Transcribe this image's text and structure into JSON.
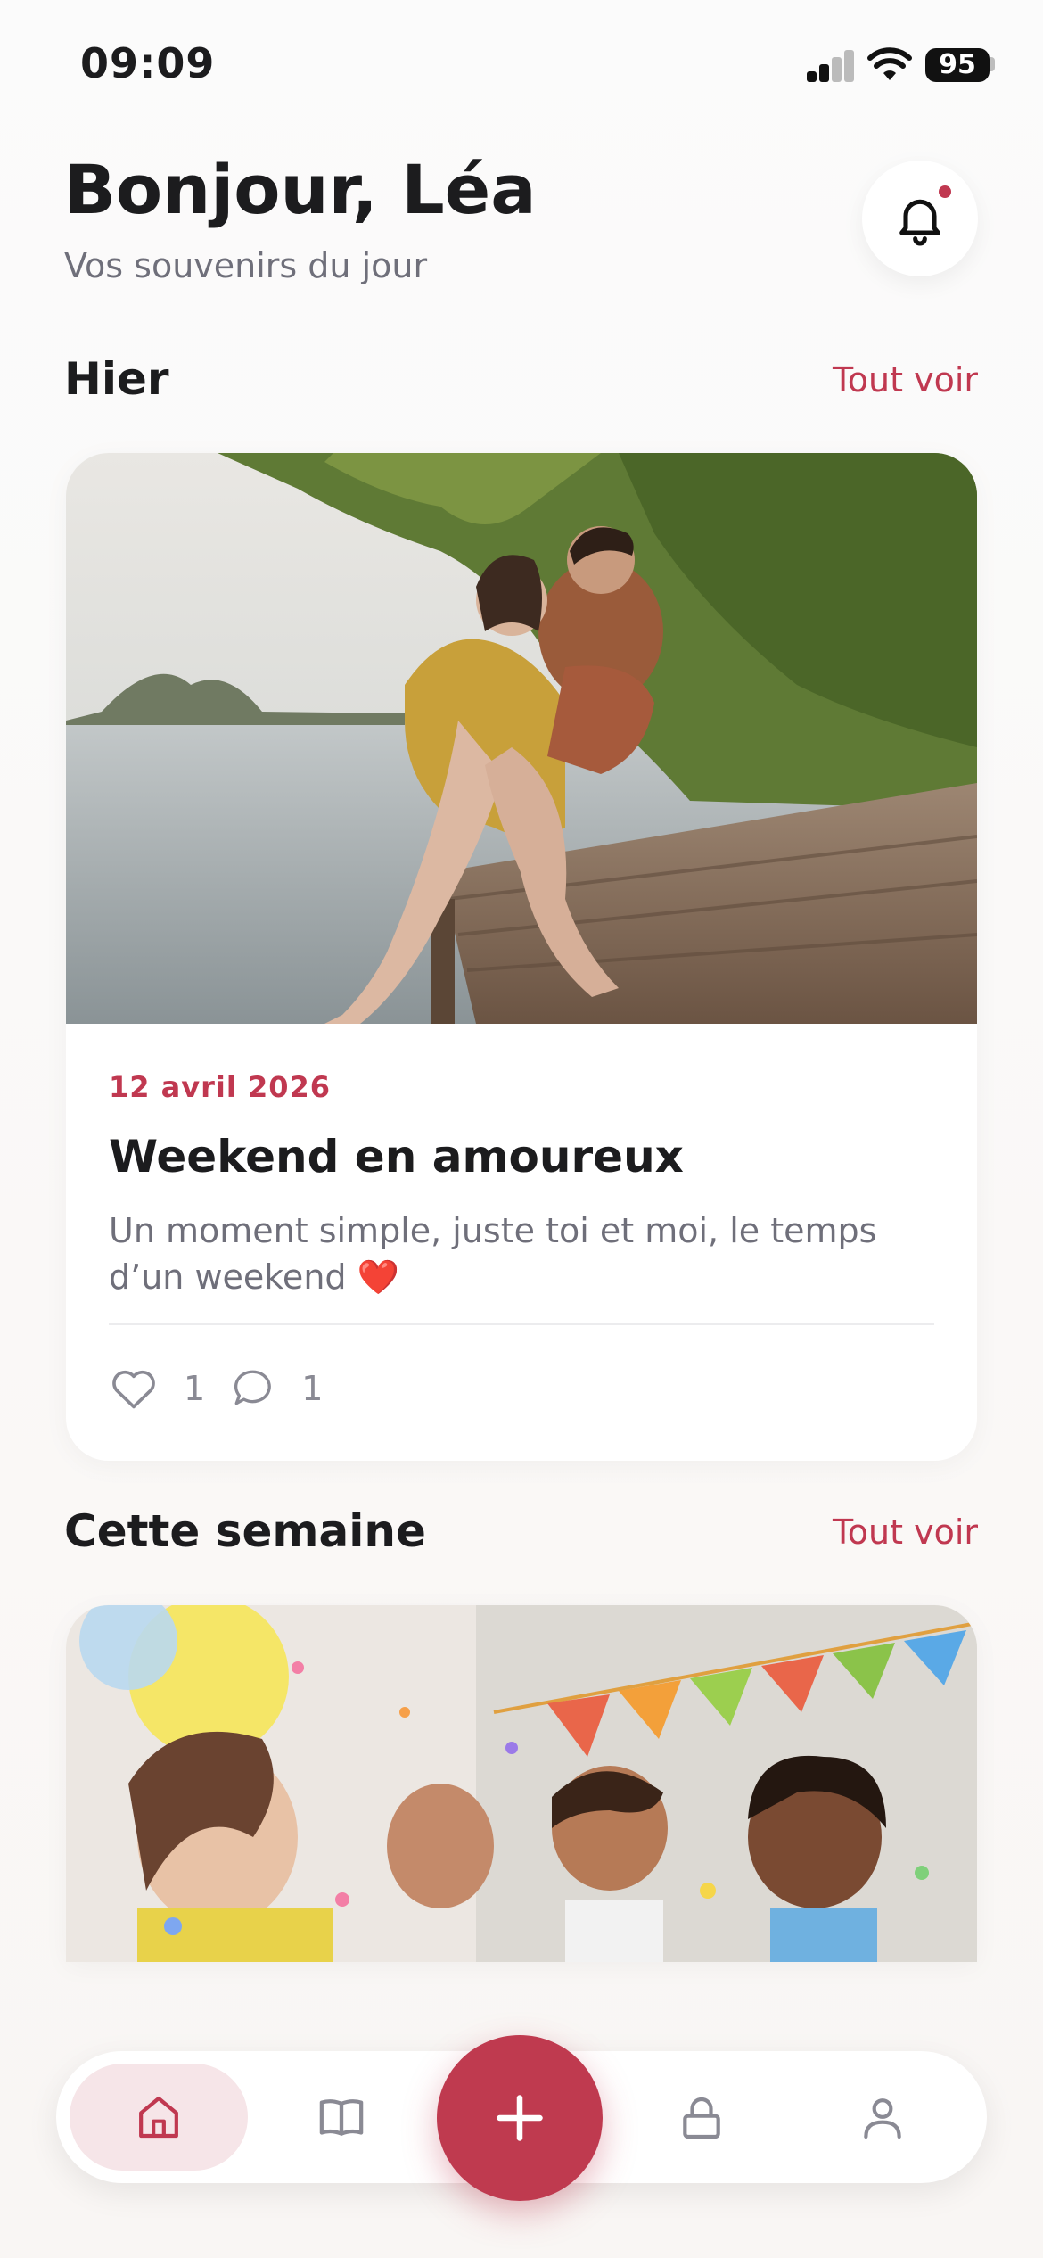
{
  "status_bar": {
    "time": "09:09",
    "battery": "95"
  },
  "header": {
    "greeting": "Bonjour, Léa",
    "subtitle": "Vos souvenirs du jour"
  },
  "sections": [
    {
      "title": "Hier",
      "see_all": "Tout voir",
      "card": {
        "date": "12 avril 2026",
        "title": "Weekend en amoureux",
        "description": "Un moment simple, juste toi et moi, le temps d’un weekend ❤️",
        "likes": "1",
        "comments": "1"
      }
    },
    {
      "title": "Cette semaine",
      "see_all": "Tout voir"
    }
  ],
  "icons": {
    "notification": "bell-icon",
    "like": "heart-icon",
    "comment": "comment-icon",
    "nav": [
      "home-icon",
      "book-icon",
      "plus-icon",
      "lock-icon",
      "user-icon"
    ]
  },
  "colors": {
    "accent": "#c03850",
    "nav_active_bg": "#f6e5e8",
    "fab": "#bf3a4f"
  }
}
